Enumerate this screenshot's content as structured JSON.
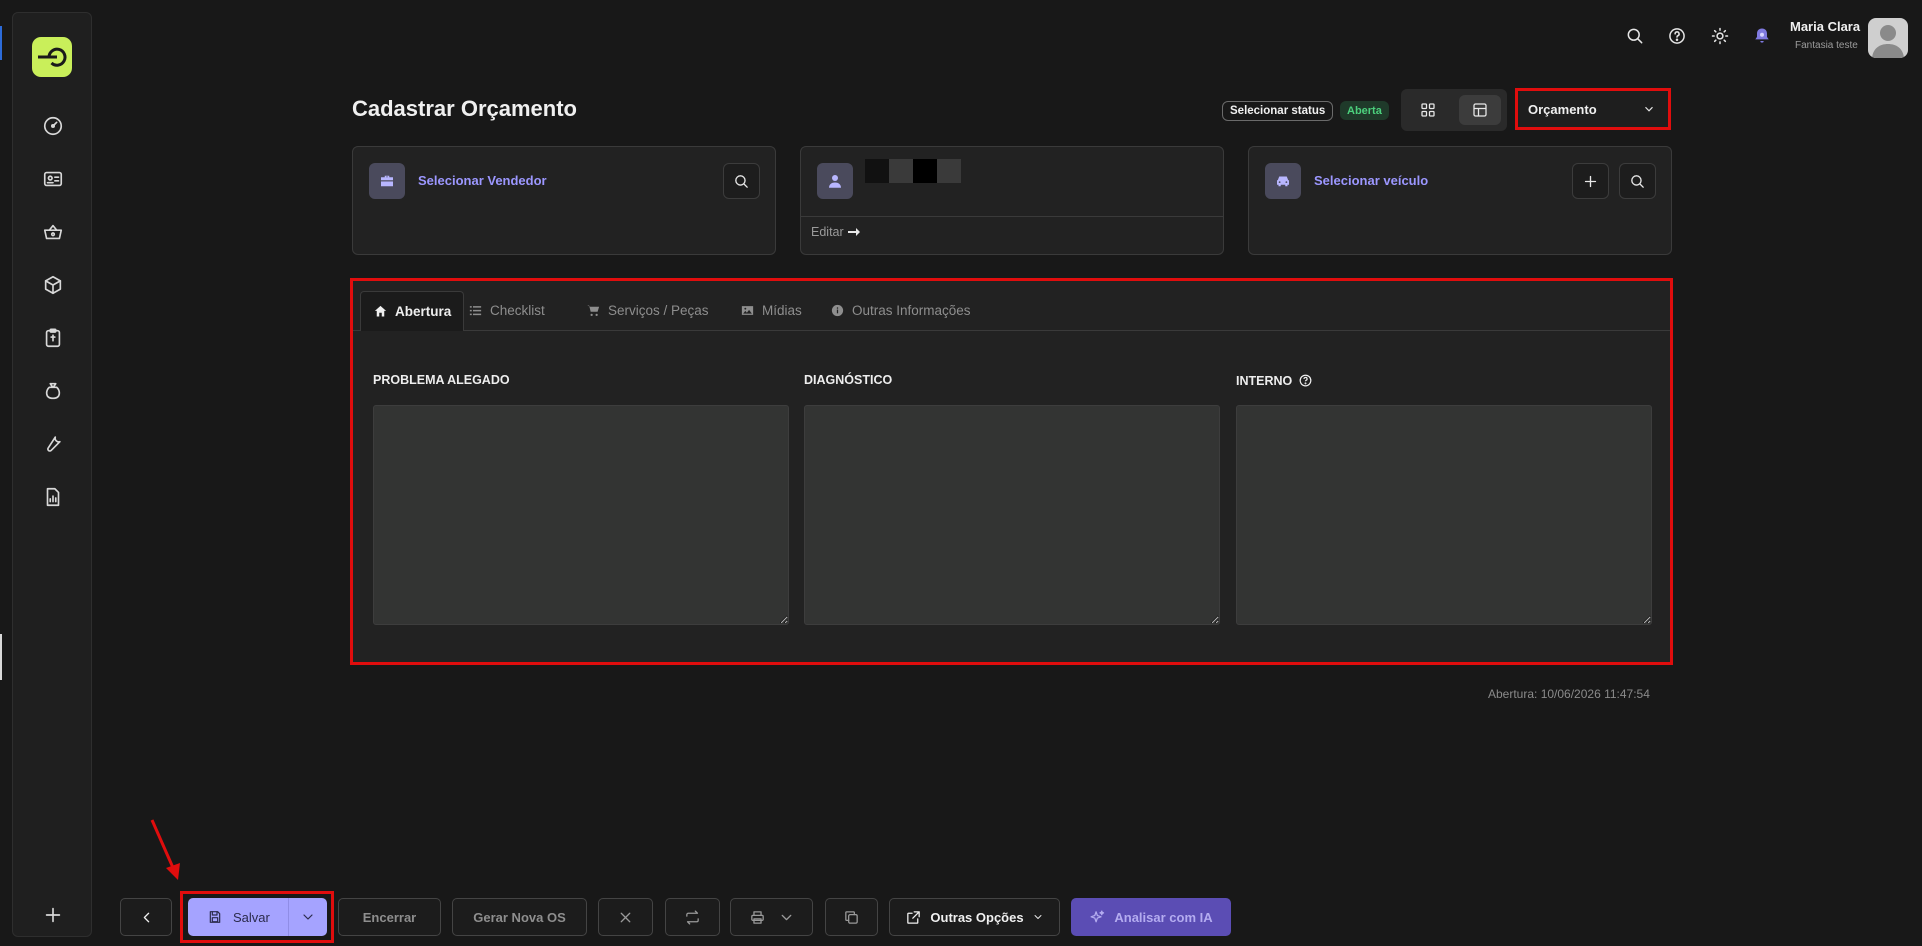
{
  "user": {
    "name": "Maria Clara",
    "company": "Fantasia teste"
  },
  "page": {
    "title": "Cadastrar Orçamento"
  },
  "status": {
    "select_label": "Selecionar status",
    "badge": "Aberta"
  },
  "doc_type": {
    "selected": "Orçamento"
  },
  "cards": {
    "vendor": {
      "label": "Selecionar Vendedor"
    },
    "client": {
      "edit_label": "Editar"
    },
    "vehicle": {
      "label": "Selecionar veículo"
    }
  },
  "tabs": [
    {
      "label": "Abertura",
      "icon": "home-icon",
      "active": true
    },
    {
      "label": "Checklist",
      "icon": "list-icon"
    },
    {
      "label": "Serviços / Peças",
      "icon": "cart-icon"
    },
    {
      "label": "Mídias",
      "icon": "image-icon"
    },
    {
      "label": "Outras Informações",
      "icon": "info-icon"
    }
  ],
  "fields": {
    "problema": {
      "label": "PROBLEMA ALEGADO",
      "value": ""
    },
    "diagnostico": {
      "label": "DIAGNÓSTICO",
      "value": ""
    },
    "interno": {
      "label": "INTERNO",
      "value": ""
    }
  },
  "opened_at": "Abertura: 10/06/2026 11:47:54",
  "toolbar": {
    "save": "Salvar",
    "encerrar": "Encerrar",
    "gerar": "Gerar Nova OS",
    "outras": "Outras Opções",
    "ia": "Analisar com IA"
  },
  "colors": {
    "accent": "#a5a3ff",
    "brand": "#c9ef5a",
    "status_open": "#4cd07d",
    "annotation": "#e00d0d"
  }
}
